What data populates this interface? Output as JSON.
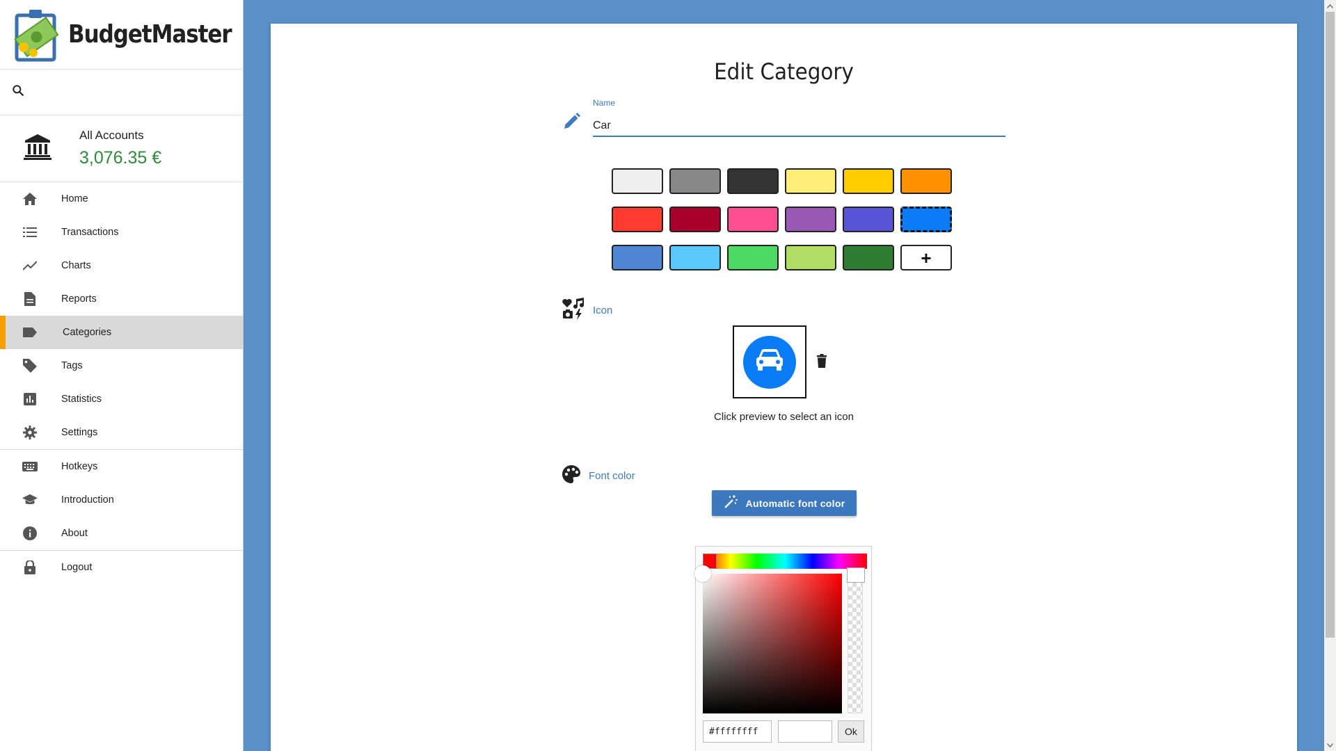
{
  "app": {
    "name": "BudgetMaster"
  },
  "search": {
    "placeholder": ""
  },
  "account": {
    "name": "All Accounts",
    "balance": "3,076.35 €",
    "balance_color": "#2e8b3a"
  },
  "nav": {
    "home": "Home",
    "transactions": "Transactions",
    "charts": "Charts",
    "reports": "Reports",
    "categories": "Categories",
    "tags": "Tags",
    "statistics": "Statistics",
    "settings": "Settings",
    "hotkeys": "Hotkeys",
    "introduction": "Introduction",
    "about": "About",
    "logout": "Logout",
    "active": "categories"
  },
  "form": {
    "title": "Edit Category",
    "name_label": "Name",
    "name_value": "Car",
    "colors": [
      "#efefef",
      "#888888",
      "#333333",
      "#ffee77",
      "#ffcc00",
      "#ff9100",
      "#ff3b30",
      "#a8002a",
      "#ff4f93",
      "#9b59b6",
      "#5a55d6",
      "#0a7cf5",
      "#4f87d6",
      "#5ac8fa",
      "#4cd964",
      "#b0de64",
      "#2e7d32"
    ],
    "selected_color": "#0a7cf5",
    "add_color_label": "+",
    "icon_label": "Icon",
    "icon_preview_icon": "car-icon",
    "icon_preview_color": "#0a7cf5",
    "icon_hint": "Click preview to select an icon",
    "font_color_label": "Font color",
    "auto_font_button": "Automatic font color",
    "picker": {
      "hex_value": "#ffffffff",
      "ok_label": "Ok"
    }
  },
  "accent_color": "#3c7bbf",
  "active_marker_color": "#f5a000"
}
